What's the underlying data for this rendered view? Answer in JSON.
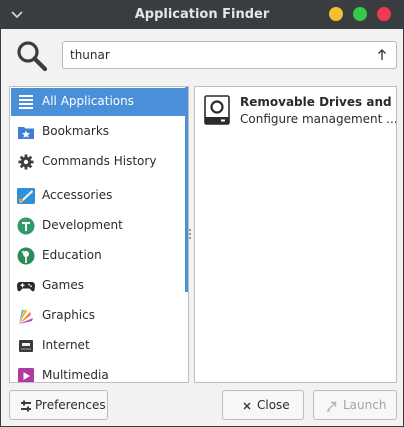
{
  "window": {
    "title": "Application Finder"
  },
  "search": {
    "value": "thunar",
    "placeholder": ""
  },
  "categories": [
    {
      "label": "All Applications",
      "icon": "list-icon",
      "selected": true
    },
    {
      "label": "Bookmarks",
      "icon": "bookmark-folder-icon"
    },
    {
      "label": "Commands History",
      "icon": "gear-icon"
    },
    {
      "label": "Accessories",
      "icon": "accessories-icon"
    },
    {
      "label": "Development",
      "icon": "development-icon"
    },
    {
      "label": "Education",
      "icon": "education-icon"
    },
    {
      "label": "Games",
      "icon": "gamepad-icon"
    },
    {
      "label": "Graphics",
      "icon": "graphics-icon"
    },
    {
      "label": "Internet",
      "icon": "internet-icon"
    },
    {
      "label": "Multimedia",
      "icon": "multimedia-icon"
    }
  ],
  "results": [
    {
      "title": "Removable Drives and ...",
      "description": "Configure management ...",
      "icon": "removable-drive-icon"
    }
  ],
  "buttons": {
    "preferences": "Preferences",
    "close": "Close",
    "launch": "Launch"
  },
  "colors": {
    "titlebar": "#393c41",
    "selection": "#4a90d9",
    "minimize": "#f6c02c",
    "maximize": "#37c94b",
    "close": "#ee3a55"
  }
}
